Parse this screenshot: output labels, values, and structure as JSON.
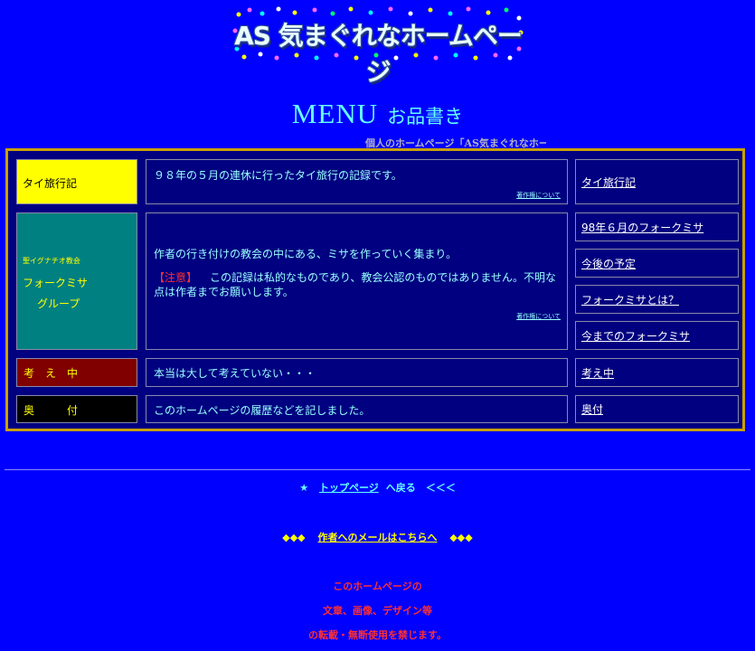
{
  "header": {
    "logo_text": "AS 気まぐれなホームページ"
  },
  "menu": {
    "title_big": "MENU",
    "title_small": "お品書き"
  },
  "marquee_text": "個人のホームページ「AS気まぐれなホーム",
  "sections": [
    {
      "label": "タイ旅行記",
      "description": "９８年の５月の連休に行ったタイ旅行の記録です。",
      "copyright_link": "著作権について",
      "links": [
        "タイ旅行記"
      ]
    },
    {
      "label_small": "聖イグナチオ教会",
      "label_line1": "フォークミサ",
      "label_line2": "グループ",
      "description": "作者の行き付けの教会の中にある、ミサを作っていく集まり。",
      "note_label": "【注意】",
      "note_text": "この記録は私的なものであり、教会公認のものではありません。不明な点は作者までお願いします。",
      "copyright_link": "著作権について",
      "links": [
        "98年６月のフォークミサ",
        "今後の予定",
        "フォークミサとは？",
        "今までのフォークミサ"
      ]
    },
    {
      "label": "考　え　中",
      "description": "本当は大して考えていない・・・",
      "links": [
        "考え中"
      ]
    },
    {
      "label": "奥　　　付",
      "description": "このホームページの履歴などを記しました。",
      "links": [
        "奥付"
      ]
    }
  ],
  "footer": {
    "star": "★",
    "top_link": "トップページ",
    "top_suffix": "へ戻る　＜＜＜",
    "mail_prefix": "◆◆◆",
    "mail_link": "作者へのメールはこちらへ",
    "mail_suffix": "◆◆◆",
    "notice_lines": [
      "このホームページの",
      "文章、画像、デザイン等",
      "の転載・無断使用を禁じます。"
    ]
  },
  "colors": {
    "background": "#0000ff",
    "frame_border": "#c8a000",
    "panel": "#000080",
    "cyan_text": "#99ffff",
    "notice": "#ff3030",
    "mail_link": "#ffff00"
  }
}
